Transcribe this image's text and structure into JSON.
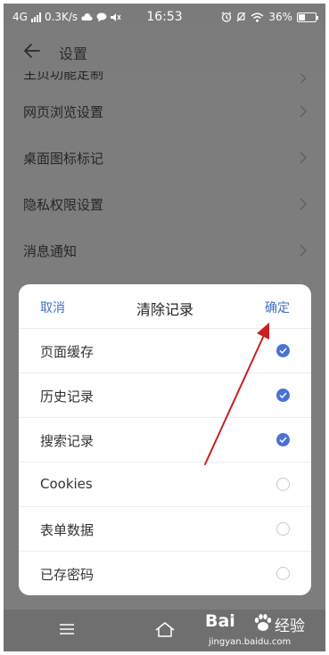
{
  "status_bar": {
    "network": "4G",
    "speed": "0.3K/s",
    "time": "16:53",
    "battery": "36%"
  },
  "header": {
    "title": "设置",
    "back_icon": "arrow-left-icon"
  },
  "settings": {
    "items": [
      {
        "label": "主页功能定制"
      },
      {
        "label": "网页浏览设置"
      },
      {
        "label": "桌面图标标记"
      },
      {
        "label": "隐私权限设置"
      },
      {
        "label": "消息通知"
      }
    ]
  },
  "dialog": {
    "cancel": "取消",
    "title": "清除记录",
    "confirm": "确定",
    "options": [
      {
        "label": "页面缓存",
        "checked": true
      },
      {
        "label": "历史记录",
        "checked": true
      },
      {
        "label": "搜索记录",
        "checked": true
      },
      {
        "label": "Cookies",
        "checked": false
      },
      {
        "label": "表单数据",
        "checked": false
      },
      {
        "label": "已存密码",
        "checked": false
      }
    ]
  },
  "watermark": {
    "logo": "Bai",
    "logo_suffix": "经验",
    "url": "jingyan.baidu.com"
  },
  "colors": {
    "accent": "#3f6fc6",
    "check": "#4a72d6",
    "annotation": "#cc1f1f"
  }
}
